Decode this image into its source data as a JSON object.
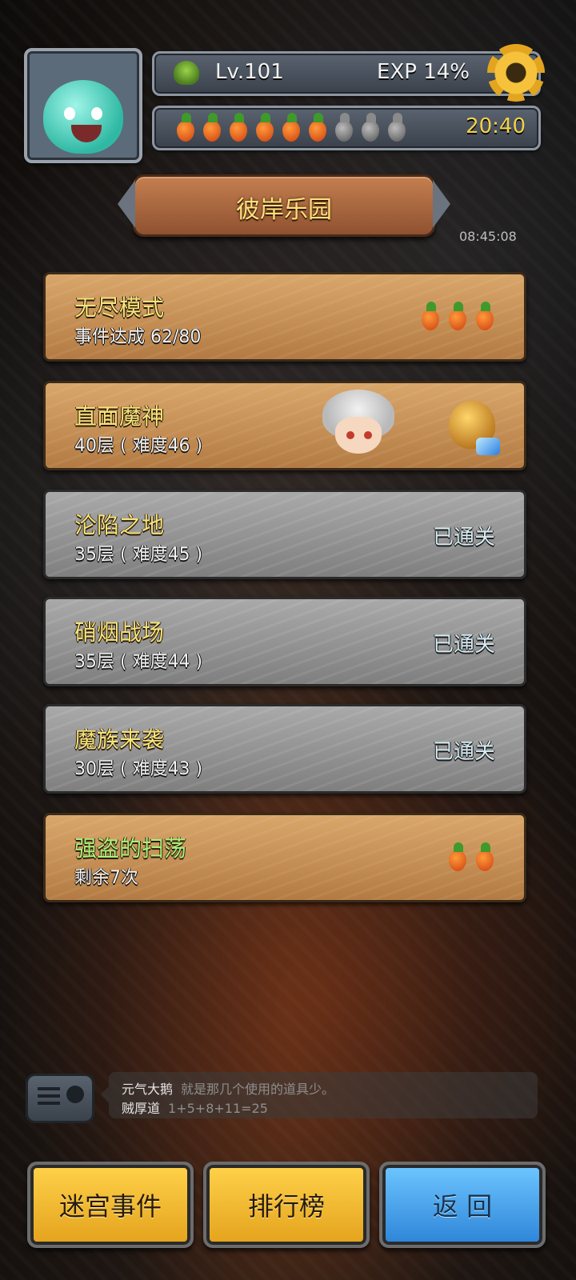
{
  "player": {
    "level_label": "Lv.101",
    "exp_label": "EXP 14%",
    "stamina_total": 9,
    "stamina_full": 6,
    "timer": "20:40"
  },
  "map_time": "08:45:08",
  "header": {
    "title": "彼岸乐园"
  },
  "modes": [
    {
      "title": "无尽模式",
      "subtitle": "事件达成 62/80",
      "status": "",
      "cost_carrots": 3,
      "style": "gold"
    },
    {
      "title": "直面魔神",
      "subtitle": "40层 ( 难度46 )",
      "status": "",
      "style": "gold"
    },
    {
      "title": "沦陷之地",
      "subtitle": "35层 ( 难度45 )",
      "status": "已通关",
      "style": "grey"
    },
    {
      "title": "硝烟战场",
      "subtitle": "35层 ( 难度44 )",
      "status": "已通关",
      "style": "grey"
    },
    {
      "title": "魔族来袭",
      "subtitle": "30层 ( 难度43 )",
      "status": "已通关",
      "style": "grey"
    },
    {
      "title": "强盗的扫荡",
      "subtitle": "剩余7次",
      "status": "",
      "cost_carrots": 2,
      "style": "gold"
    }
  ],
  "chat": [
    {
      "name": "元气大鹅",
      "message": "就是那几个使用的道具少。"
    },
    {
      "name": "贼厚道",
      "message": "1+5+8+11=25"
    }
  ],
  "buttons": {
    "maze_events": "迷宫事件",
    "leaderboard": "排行榜",
    "back": "返 回"
  },
  "icons": {
    "level": "tree-icon",
    "settings": "gear-icon",
    "stamina": "carrot-icon",
    "chat": "radio-icon",
    "reward": "treasure-bag-icon"
  }
}
